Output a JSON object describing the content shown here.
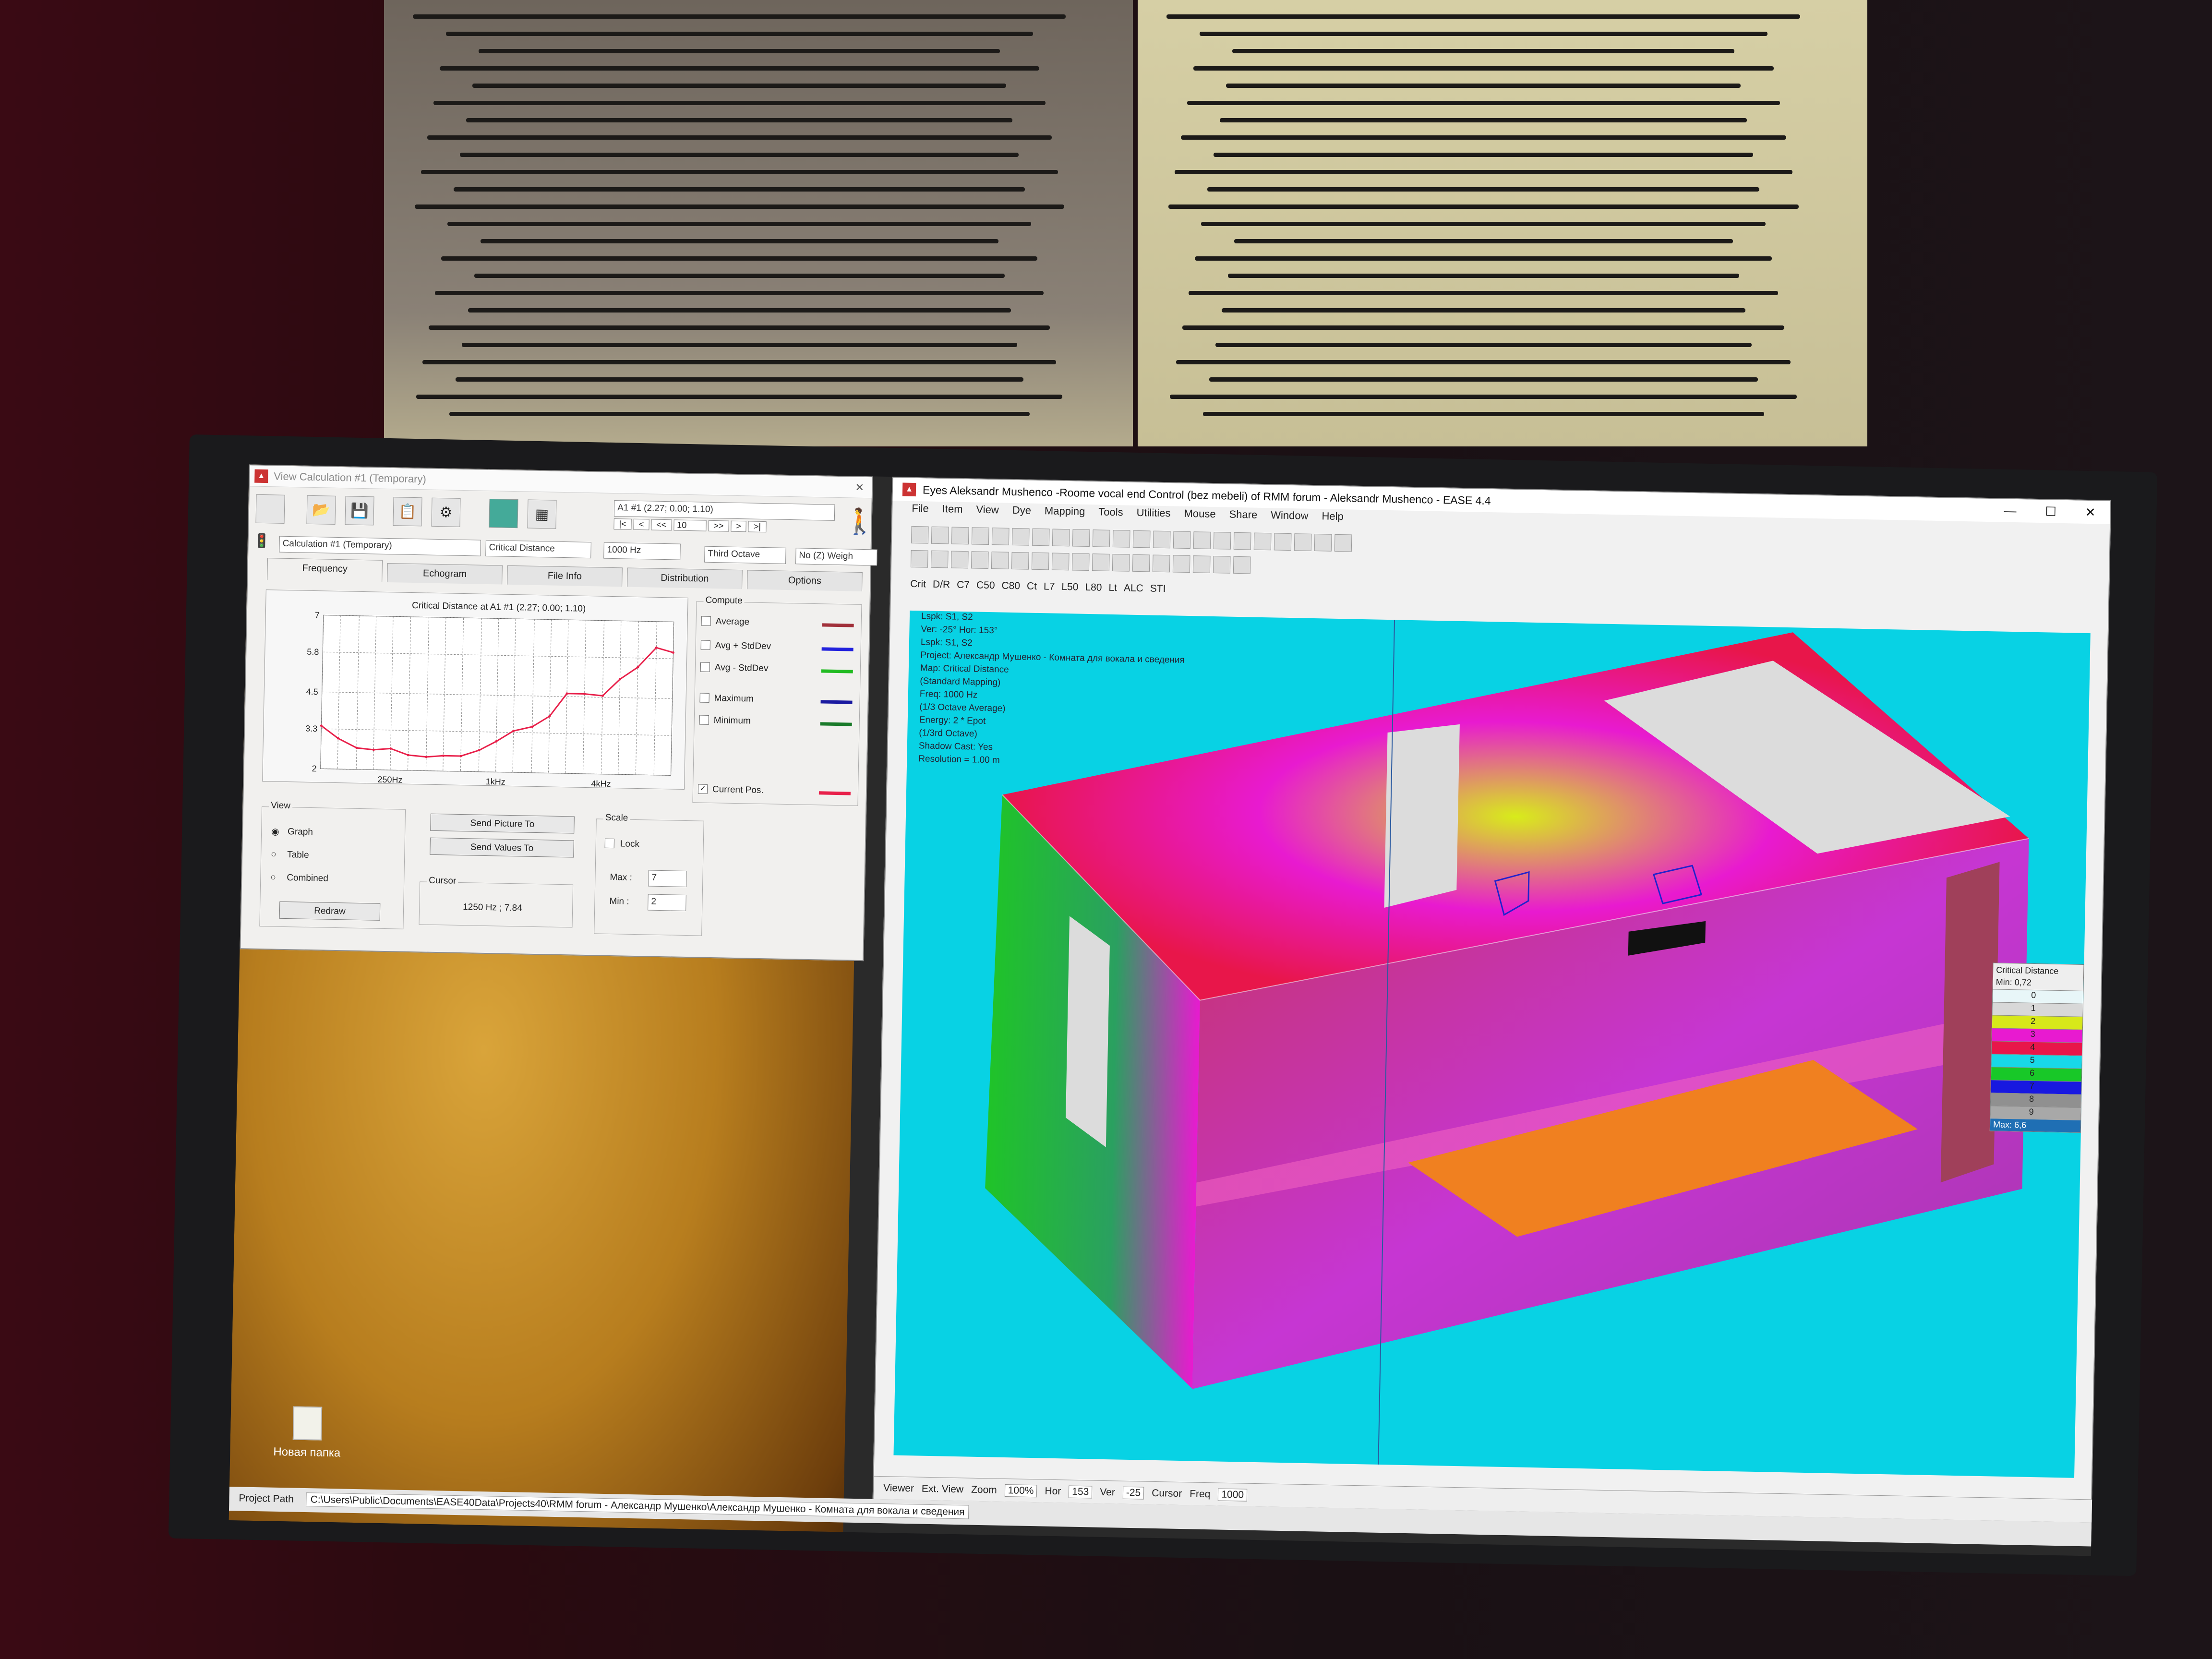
{
  "desktop": {
    "folder_label": "Новая папка"
  },
  "view_calc": {
    "title": "View Calculation #1 (Temporary)",
    "position": "A1 #1  (2.27; 0.00; 1.10)",
    "step_value": "10",
    "nav": [
      "|<",
      "<",
      "<<",
      ">>",
      ">",
      ">|"
    ],
    "calc_select": "Calculation #1 (Temporary)",
    "quantity_select": "Critical Distance",
    "freq_value": "1000 Hz",
    "band_select": "Third Octave",
    "weight_select": "No (Z) Weigh",
    "tabs": [
      "Frequency",
      "Echogram",
      "File Info",
      "Distribution",
      "Options"
    ],
    "chart_title": "Critical Distance at A1 #1  (2.27; 0.00; 1.10)",
    "compute_title": "Compute",
    "compute_items": [
      {
        "label": "Average",
        "color": "#a1303a"
      },
      {
        "label": "Avg + StdDev",
        "color": "#2222dd"
      },
      {
        "label": "Avg - StdDev",
        "color": "#22bb22"
      },
      {
        "label": "Maximum",
        "color": "#1a1aa0"
      },
      {
        "label": "Minimum",
        "color": "#1a7a2a"
      }
    ],
    "current_pos_label": "Current Pos.",
    "current_pos_color": "#e8204a",
    "view_title": "View",
    "view_options": [
      "Graph",
      "Table",
      "Combined"
    ],
    "redraw_label": "Redraw",
    "send_picture_label": "Send Picture To",
    "send_values_label": "Send Values To",
    "cursor_title": "Cursor",
    "cursor_value": "1250 Hz ; 7.84",
    "scale_title": "Scale",
    "lock_label": "Lock",
    "max_label": "Max :",
    "max_value": "7",
    "min_label": "Min :",
    "min_value": "2"
  },
  "chart_data": {
    "type": "line",
    "title": "Critical Distance at A1 #1  (2.27; 0.00; 1.10)",
    "x_tick_labels": [
      "250Hz",
      "1kHz",
      "4kHz"
    ],
    "y_tick_labels": [
      "7",
      "5.8",
      "4.5",
      "3.3",
      "2"
    ],
    "ylim": [
      2,
      7
    ],
    "grid": true,
    "series": [
      {
        "name": "Current Pos.",
        "color": "#e8204a",
        "x": [
          100,
          125,
          160,
          200,
          250,
          315,
          400,
          500,
          630,
          800,
          1000,
          1250,
          1600,
          2000,
          2500,
          3150,
          4000,
          5000,
          6300,
          8000,
          10000
        ],
        "values": [
          3.4,
          3.0,
          2.7,
          2.65,
          2.7,
          2.5,
          2.45,
          2.5,
          2.5,
          2.7,
          3.0,
          3.35,
          3.5,
          3.85,
          4.6,
          4.6,
          4.55,
          5.1,
          5.5,
          6.15,
          6.0
        ]
      }
    ]
  },
  "ease": {
    "title": "Eyes Aleksandr Mushenco -Roome vocal end Control  (bez mebeli) of RMM forum - Aleksandr Mushenco - EASE 4.4",
    "menu": [
      "File",
      "Item",
      "View",
      "Dye",
      "Mapping",
      "Tools",
      "Utilities",
      "Mouse",
      "Share",
      "Window",
      "Help"
    ],
    "toolbar_text": [
      "Crit",
      "D/R",
      "C7",
      "C50",
      "C80",
      "Ct",
      "L7",
      "L50",
      "L80",
      "Lt",
      "ALC",
      "STI"
    ],
    "info_lines": [
      "Lspk: S1, S2",
      "Ver: -25°  Hor: 153°",
      "Lspk: S1, S2",
      "Project: Александр Мушенко - Комната для вокала и сведения",
      "Map: Critical Distance",
      "(Standard Mapping)",
      "Freq: 1000 Hz",
      "(1/3 Octave Average)",
      "Energy: 2 * Epot",
      "(1/3rd Octave)",
      "Shadow Cast: Yes",
      "Resolution = 1.00 m"
    ],
    "legend": {
      "title": "Critical Distance",
      "min_label": "Min: 0,72",
      "max_label": "Max: 6,6",
      "rows": [
        {
          "label": "0",
          "color": "#e8f6f8"
        },
        {
          "label": "1",
          "color": "#d8d8d8"
        },
        {
          "label": "2",
          "color": "#d7e81a"
        },
        {
          "label": "3",
          "color": "#e81ad0"
        },
        {
          "label": "4",
          "color": "#e8164a"
        },
        {
          "label": "5",
          "color": "#18d8e8"
        },
        {
          "label": "6",
          "color": "#18c828"
        },
        {
          "label": "7",
          "color": "#1818e0"
        },
        {
          "label": "8",
          "color": "#909090"
        },
        {
          "label": "9",
          "color": "#a8a8a8"
        }
      ]
    },
    "status": {
      "viewer": "Viewer",
      "ext_view": "Ext. View",
      "zoom_label": "Zoom",
      "zoom_value": "100%",
      "hor_label": "Hor",
      "hor_value": "153",
      "ver_label": "Ver",
      "ver_value": "-25",
      "cursor_label": "Cursor",
      "freq_label": "Freq",
      "freq_value": "1000"
    },
    "project_path_label": "Project Path",
    "project_path": "C:\\Users\\Public\\Documents\\EASE40Data\\Projects40\\RMM forum - Александр Мушенко\\Александр Мушенко - Комната для вокала и сведения"
  }
}
